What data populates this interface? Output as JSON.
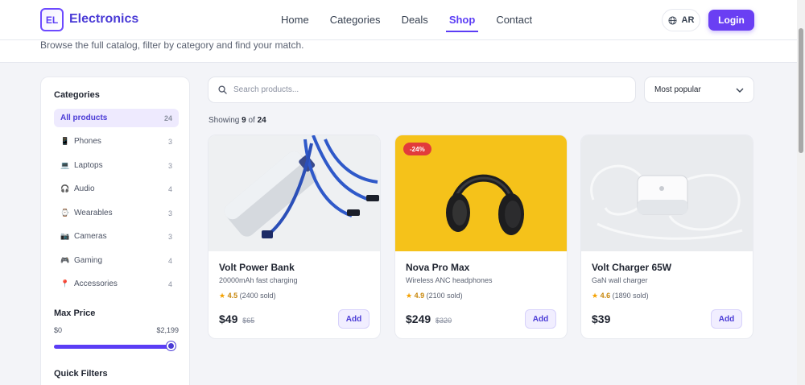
{
  "brand": {
    "logo_text": "EL",
    "name": "Electronics"
  },
  "nav": {
    "items": [
      {
        "label": "Home"
      },
      {
        "label": "Categories"
      },
      {
        "label": "Deals"
      },
      {
        "label": "Shop"
      },
      {
        "label": "Contact"
      }
    ],
    "active": "Shop"
  },
  "header": {
    "lang_label": "AR",
    "login_label": "Login"
  },
  "hero": {
    "subtitle": "Browse the full catalog, filter by category and find your match."
  },
  "sidebar": {
    "categories_title": "Categories",
    "categories": [
      {
        "icon": "grid-icon",
        "label": "All products",
        "count": "24"
      },
      {
        "icon": "phone-icon",
        "label": "Phones",
        "count": "3"
      },
      {
        "icon": "laptop-icon",
        "label": "Laptops",
        "count": "3"
      },
      {
        "icon": "headphones-icon",
        "label": "Audio",
        "count": "4"
      },
      {
        "icon": "watch-icon",
        "label": "Wearables",
        "count": "3"
      },
      {
        "icon": "camera-icon",
        "label": "Cameras",
        "count": "3"
      },
      {
        "icon": "gamepad-icon",
        "label": "Gaming",
        "count": "4"
      },
      {
        "icon": "pin-icon",
        "label": "Accessories",
        "count": "4"
      }
    ],
    "max_price_title": "Max Price",
    "price_min": "$0",
    "price_max": "$2,199",
    "price_fill": 1.0,
    "quick_filters_title": "Quick Filters"
  },
  "search": {
    "placeholder": "Search products..."
  },
  "sort": {
    "selected": "Most popular"
  },
  "results": {
    "prefix": "Showing",
    "shown": "9",
    "of": "of",
    "total": "24"
  },
  "products": [
    {
      "name": "Volt Power Bank",
      "desc": "20000mAh fast charging",
      "rating": "4.5",
      "sold": "(2400 sold)",
      "price": "$49",
      "old_price": "$65",
      "badge": "",
      "add_label": "Add"
    },
    {
      "name": "Nova Pro Max",
      "desc": "Wireless ANC headphones",
      "rating": "4.9",
      "sold": "(2100 sold)",
      "price": "$249",
      "old_price": "$320",
      "badge": "-24%",
      "add_label": "Add"
    },
    {
      "name": "Volt Charger 65W",
      "desc": "GaN wall charger",
      "rating": "4.6",
      "sold": "(1890 sold)",
      "price": "$39",
      "old_price": "",
      "badge": "",
      "add_label": "Add"
    }
  ],
  "colors": {
    "accent": "#5b3df5",
    "login": "#6a3ff3",
    "badge": "#e23b3b",
    "star": "#f4a100"
  }
}
